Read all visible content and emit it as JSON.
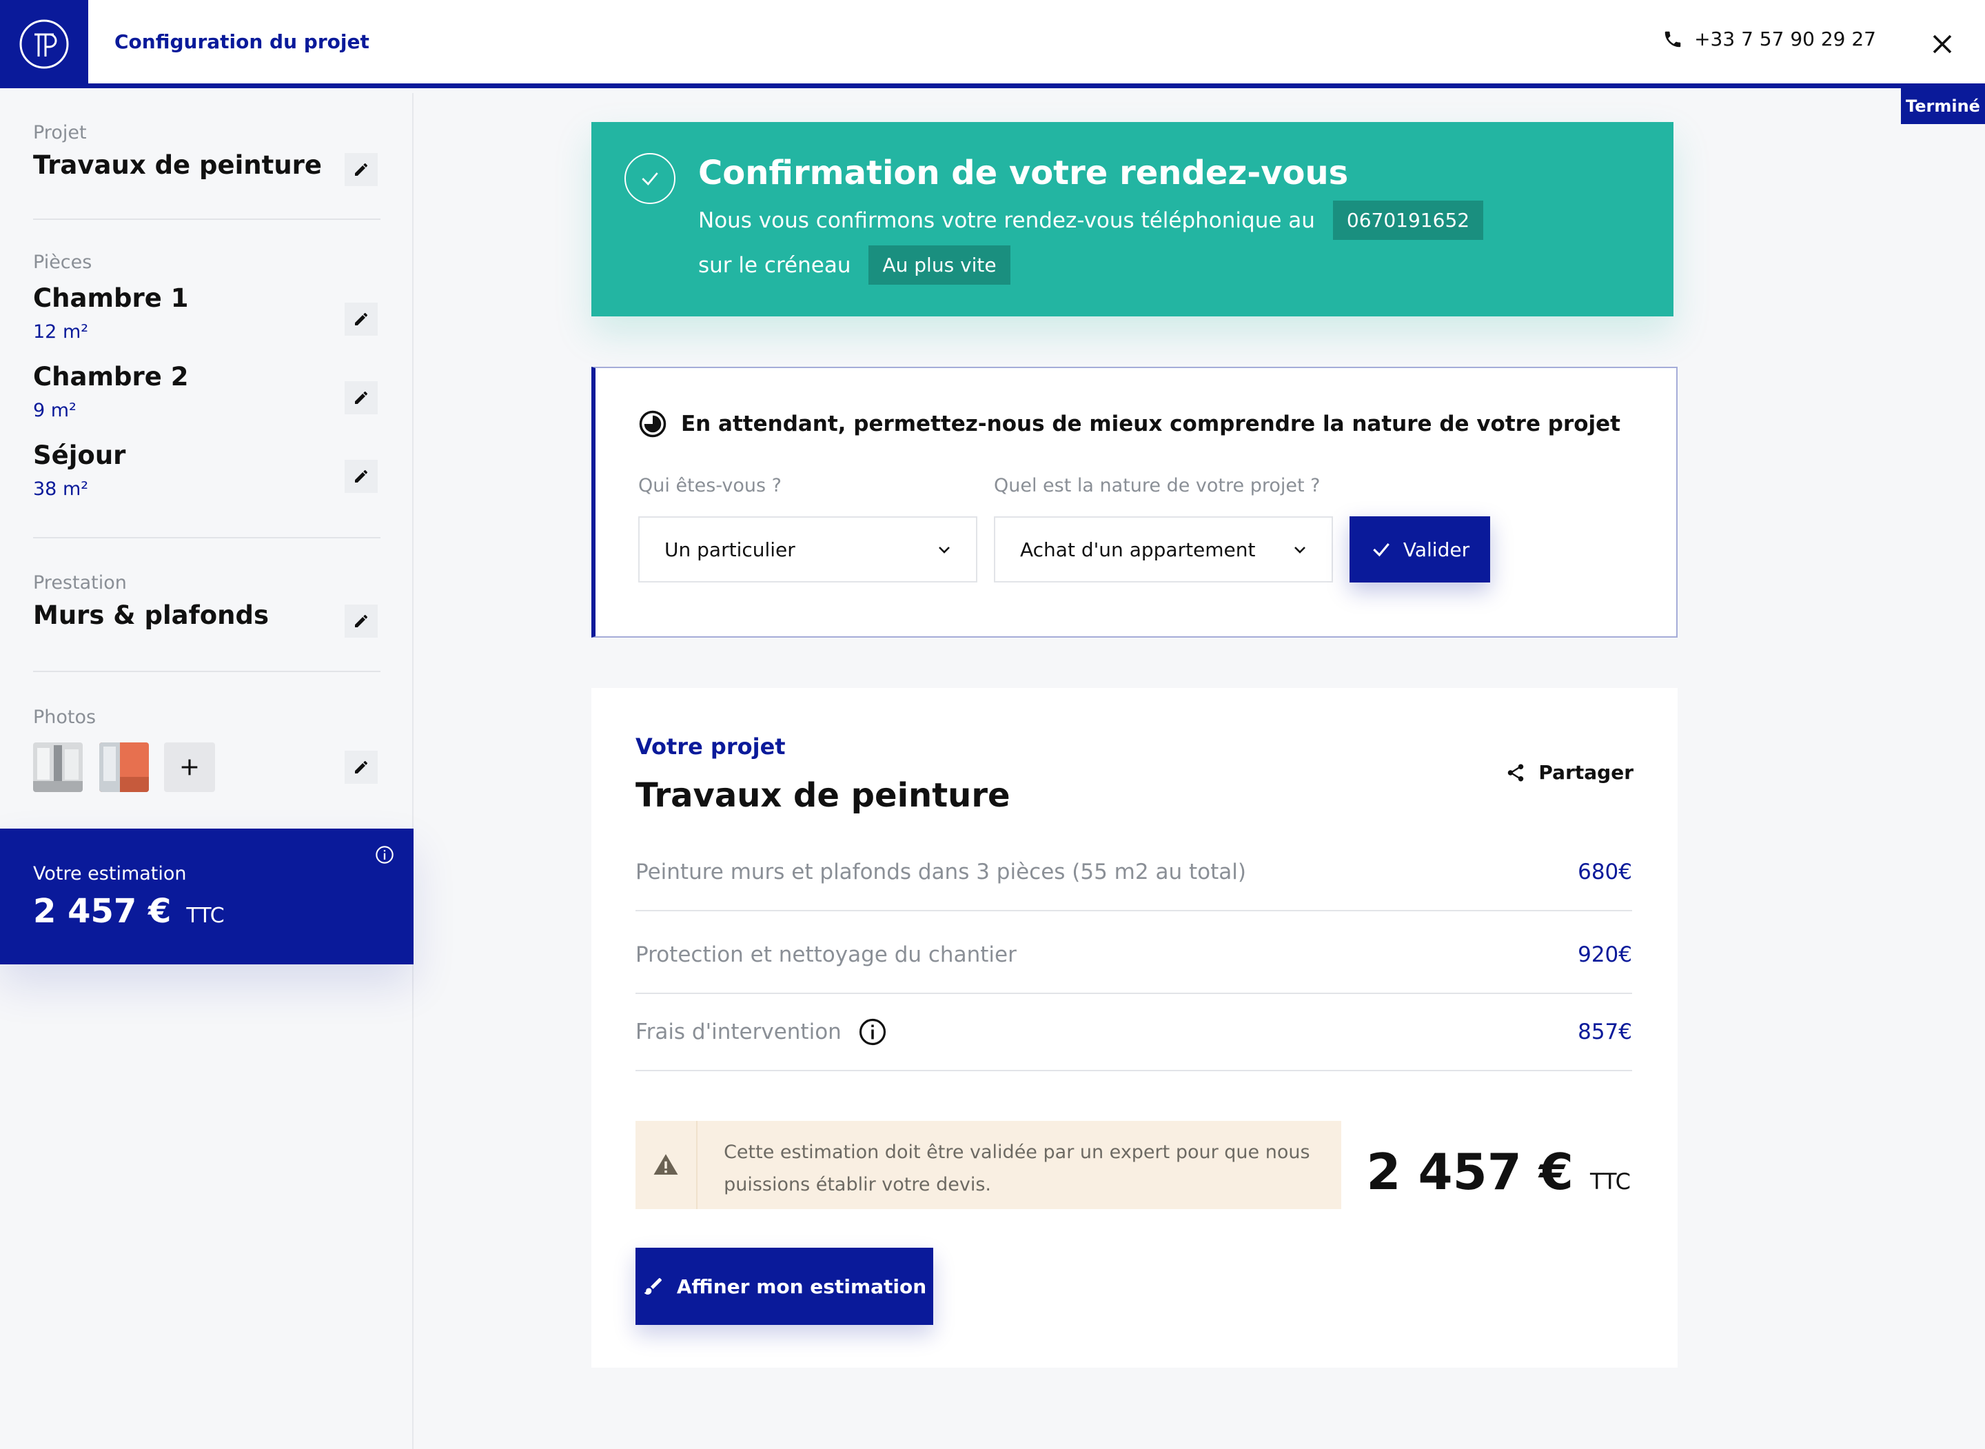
{
  "header": {
    "title": "Configuration du projet",
    "phone": "+33 7 57 90 29 27",
    "status_tag": "Terminé",
    "logo_icon": "brand-logo-icon",
    "close_icon": "close-icon"
  },
  "sidebar": {
    "project": {
      "label": "Projet",
      "value": "Travaux de peinture"
    },
    "rooms": {
      "label": "Pièces",
      "items": [
        {
          "name": "Chambre 1",
          "area": "12 m²"
        },
        {
          "name": "Chambre 2",
          "area": "9 m²"
        },
        {
          "name": "Séjour",
          "area": "38 m²"
        }
      ]
    },
    "service": {
      "label": "Prestation",
      "value": "Murs & plafonds"
    },
    "photos": {
      "label": "Photos"
    },
    "estimate": {
      "label": "Votre estimation",
      "value": "2 457 €",
      "suffix": "TTC"
    }
  },
  "confirmation": {
    "title": "Confirmation de votre rendez-vous",
    "line1": "Nous vous confirmons votre rendez-vous téléphonique au",
    "phone_chip": "0670191652",
    "line2": "sur le créneau",
    "slot_chip": "Au plus vite"
  },
  "questions": {
    "heading": "En attendant, permettez-nous de mieux comprendre la nature de votre projet",
    "who_label": "Qui êtes-vous ?",
    "who_value": "Un particulier",
    "nature_label": "Quel est la nature de votre projet ?",
    "nature_value": "Achat d'un appartement",
    "validate_label": "Valider"
  },
  "project": {
    "kicker": "Votre projet",
    "title": "Travaux de peinture",
    "share_label": "Partager",
    "lines": [
      {
        "label": "Peinture murs et plafonds dans 3 pièces (55 m2 au total)",
        "price": "680€"
      },
      {
        "label": "Protection et nettoyage du chantier",
        "price": "920€"
      },
      {
        "label": "Frais d'intervention",
        "price": "857€"
      }
    ],
    "warning": "Cette estimation doit être validée par un expert pour que nous puissions établir votre devis.",
    "total_value": "2 457 €",
    "total_suffix": "TTC",
    "refine_label": "Affiner mon estimation"
  },
  "colors": {
    "brand": "#0a1a9a",
    "success": "#23b5a2",
    "warning_bg": "#f9efe2",
    "background": "#f6f7f9"
  }
}
